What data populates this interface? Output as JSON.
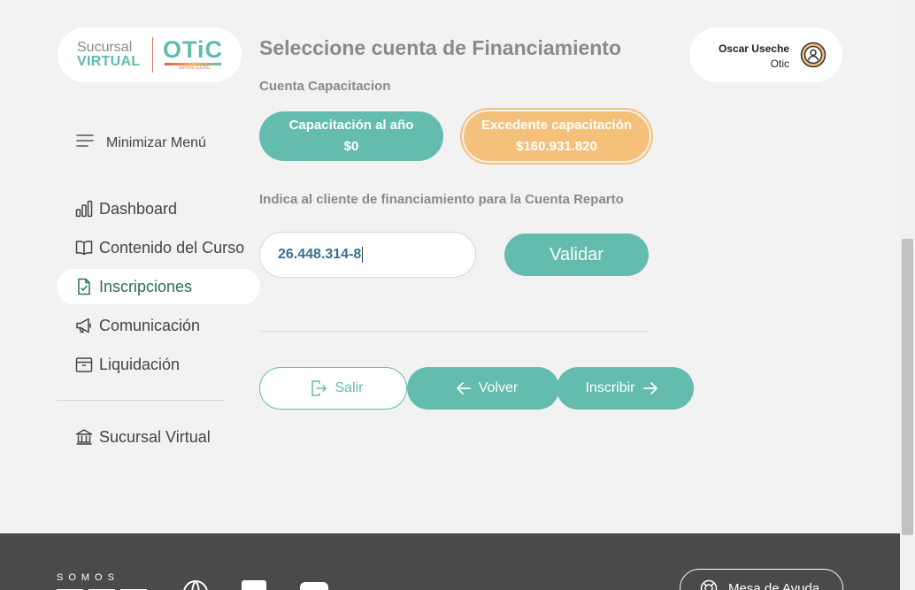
{
  "logo": {
    "line1": "Sucursal",
    "line2": "VIRTUAL",
    "brand": "OTiC",
    "brand_sub": "somos CChC"
  },
  "sidebar": {
    "minimize_label": "Minimizar Menú",
    "items": [
      {
        "label": "Dashboard",
        "icon": "bar-chart-icon"
      },
      {
        "label": "Contenido del Curso",
        "icon": "book-icon"
      },
      {
        "label": "Inscripciones",
        "icon": "document-check-icon"
      },
      {
        "label": "Comunicación",
        "icon": "megaphone-icon"
      },
      {
        "label": "Liquidación",
        "icon": "wallet-icon"
      }
    ],
    "bottom_item": {
      "label": "Sucursal Virtual",
      "icon": "bank-icon"
    }
  },
  "main": {
    "title": "Seleccione cuenta de Financiamiento",
    "account_section_label": "Cuenta Capacitacion",
    "accounts": [
      {
        "label": "Capacitación al año",
        "amount": "$0"
      },
      {
        "label": "Excedente capacitación",
        "amount": "$160.931.820"
      }
    ],
    "client_label": "Indica al cliente de financiamiento para la Cuenta Reparto",
    "rut_value": "26.448.314-8",
    "validate_label": "Validar",
    "actions": {
      "exit": "Salir",
      "back": "Volver",
      "enroll": "Inscribir"
    }
  },
  "user": {
    "name": "Oscar Useche",
    "org": "Otic"
  },
  "footer": {
    "somos": "SOMOS",
    "help_label": "Mesa de Ayuda"
  },
  "colors": {
    "accent": "#63bcae",
    "highlight": "#f5c07a",
    "footer_bg": "#4a4a4a"
  }
}
